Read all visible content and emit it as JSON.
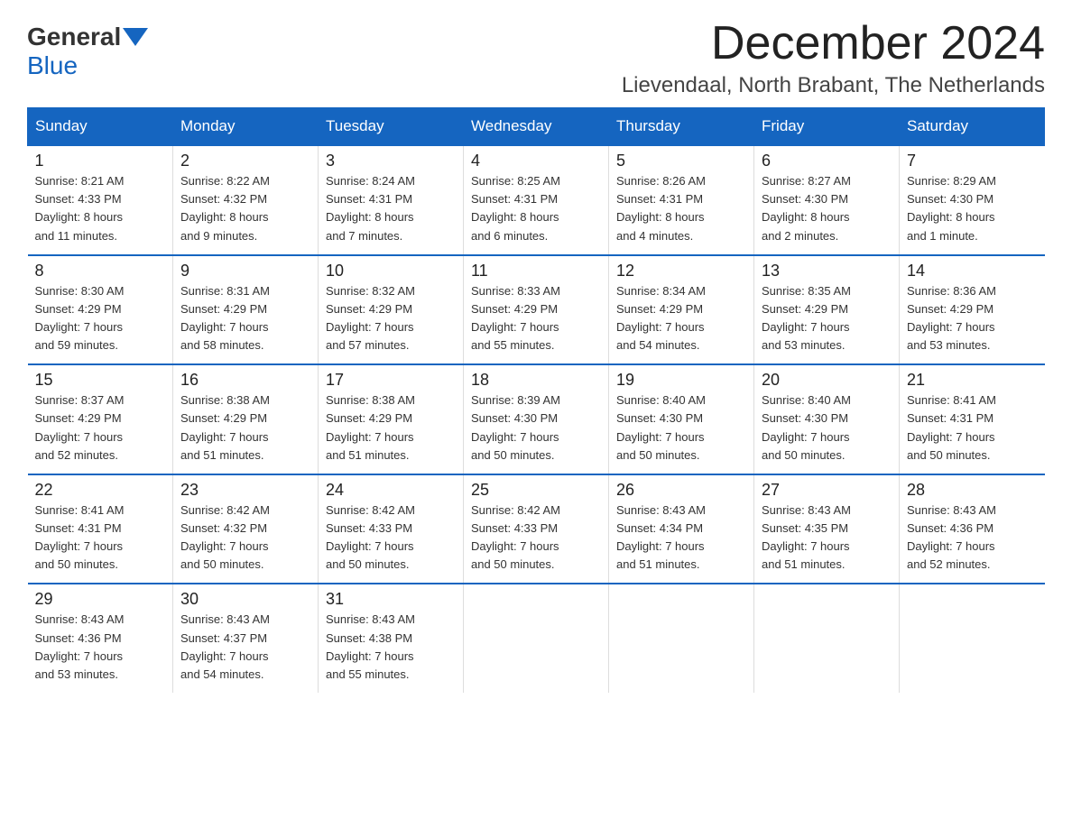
{
  "logo": {
    "general": "General",
    "blue": "Blue"
  },
  "header": {
    "title": "December 2024",
    "location": "Lievendaal, North Brabant, The Netherlands"
  },
  "weekdays": [
    "Sunday",
    "Monday",
    "Tuesday",
    "Wednesday",
    "Thursday",
    "Friday",
    "Saturday"
  ],
  "weeks": [
    [
      {
        "day": "1",
        "info": "Sunrise: 8:21 AM\nSunset: 4:33 PM\nDaylight: 8 hours\nand 11 minutes."
      },
      {
        "day": "2",
        "info": "Sunrise: 8:22 AM\nSunset: 4:32 PM\nDaylight: 8 hours\nand 9 minutes."
      },
      {
        "day": "3",
        "info": "Sunrise: 8:24 AM\nSunset: 4:31 PM\nDaylight: 8 hours\nand 7 minutes."
      },
      {
        "day": "4",
        "info": "Sunrise: 8:25 AM\nSunset: 4:31 PM\nDaylight: 8 hours\nand 6 minutes."
      },
      {
        "day": "5",
        "info": "Sunrise: 8:26 AM\nSunset: 4:31 PM\nDaylight: 8 hours\nand 4 minutes."
      },
      {
        "day": "6",
        "info": "Sunrise: 8:27 AM\nSunset: 4:30 PM\nDaylight: 8 hours\nand 2 minutes."
      },
      {
        "day": "7",
        "info": "Sunrise: 8:29 AM\nSunset: 4:30 PM\nDaylight: 8 hours\nand 1 minute."
      }
    ],
    [
      {
        "day": "8",
        "info": "Sunrise: 8:30 AM\nSunset: 4:29 PM\nDaylight: 7 hours\nand 59 minutes."
      },
      {
        "day": "9",
        "info": "Sunrise: 8:31 AM\nSunset: 4:29 PM\nDaylight: 7 hours\nand 58 minutes."
      },
      {
        "day": "10",
        "info": "Sunrise: 8:32 AM\nSunset: 4:29 PM\nDaylight: 7 hours\nand 57 minutes."
      },
      {
        "day": "11",
        "info": "Sunrise: 8:33 AM\nSunset: 4:29 PM\nDaylight: 7 hours\nand 55 minutes."
      },
      {
        "day": "12",
        "info": "Sunrise: 8:34 AM\nSunset: 4:29 PM\nDaylight: 7 hours\nand 54 minutes."
      },
      {
        "day": "13",
        "info": "Sunrise: 8:35 AM\nSunset: 4:29 PM\nDaylight: 7 hours\nand 53 minutes."
      },
      {
        "day": "14",
        "info": "Sunrise: 8:36 AM\nSunset: 4:29 PM\nDaylight: 7 hours\nand 53 minutes."
      }
    ],
    [
      {
        "day": "15",
        "info": "Sunrise: 8:37 AM\nSunset: 4:29 PM\nDaylight: 7 hours\nand 52 minutes."
      },
      {
        "day": "16",
        "info": "Sunrise: 8:38 AM\nSunset: 4:29 PM\nDaylight: 7 hours\nand 51 minutes."
      },
      {
        "day": "17",
        "info": "Sunrise: 8:38 AM\nSunset: 4:29 PM\nDaylight: 7 hours\nand 51 minutes."
      },
      {
        "day": "18",
        "info": "Sunrise: 8:39 AM\nSunset: 4:30 PM\nDaylight: 7 hours\nand 50 minutes."
      },
      {
        "day": "19",
        "info": "Sunrise: 8:40 AM\nSunset: 4:30 PM\nDaylight: 7 hours\nand 50 minutes."
      },
      {
        "day": "20",
        "info": "Sunrise: 8:40 AM\nSunset: 4:30 PM\nDaylight: 7 hours\nand 50 minutes."
      },
      {
        "day": "21",
        "info": "Sunrise: 8:41 AM\nSunset: 4:31 PM\nDaylight: 7 hours\nand 50 minutes."
      }
    ],
    [
      {
        "day": "22",
        "info": "Sunrise: 8:41 AM\nSunset: 4:31 PM\nDaylight: 7 hours\nand 50 minutes."
      },
      {
        "day": "23",
        "info": "Sunrise: 8:42 AM\nSunset: 4:32 PM\nDaylight: 7 hours\nand 50 minutes."
      },
      {
        "day": "24",
        "info": "Sunrise: 8:42 AM\nSunset: 4:33 PM\nDaylight: 7 hours\nand 50 minutes."
      },
      {
        "day": "25",
        "info": "Sunrise: 8:42 AM\nSunset: 4:33 PM\nDaylight: 7 hours\nand 50 minutes."
      },
      {
        "day": "26",
        "info": "Sunrise: 8:43 AM\nSunset: 4:34 PM\nDaylight: 7 hours\nand 51 minutes."
      },
      {
        "day": "27",
        "info": "Sunrise: 8:43 AM\nSunset: 4:35 PM\nDaylight: 7 hours\nand 51 minutes."
      },
      {
        "day": "28",
        "info": "Sunrise: 8:43 AM\nSunset: 4:36 PM\nDaylight: 7 hours\nand 52 minutes."
      }
    ],
    [
      {
        "day": "29",
        "info": "Sunrise: 8:43 AM\nSunset: 4:36 PM\nDaylight: 7 hours\nand 53 minutes."
      },
      {
        "day": "30",
        "info": "Sunrise: 8:43 AM\nSunset: 4:37 PM\nDaylight: 7 hours\nand 54 minutes."
      },
      {
        "day": "31",
        "info": "Sunrise: 8:43 AM\nSunset: 4:38 PM\nDaylight: 7 hours\nand 55 minutes."
      },
      null,
      null,
      null,
      null
    ]
  ]
}
